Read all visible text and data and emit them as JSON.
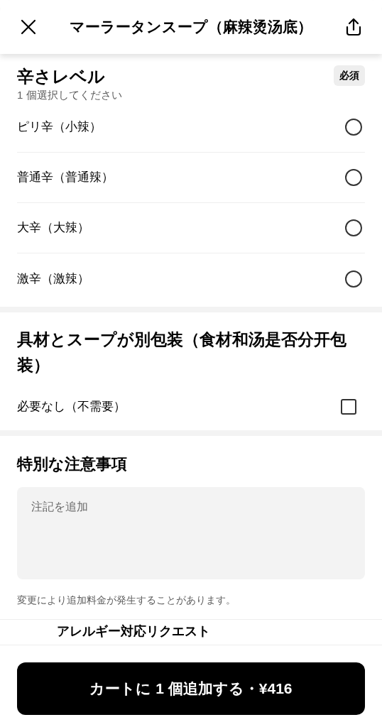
{
  "header": {
    "title": "マーラータンスープ（麻辣烫汤底）"
  },
  "spice_section": {
    "title": "辛さレベル",
    "badge": "必須",
    "subtitle": "1 個選択してください",
    "options": [
      {
        "label": "ピリ辛（小辣）",
        "selected": false
      },
      {
        "label": "普通辛（普通辣）",
        "selected": false
      },
      {
        "label": "大辛（大辣）",
        "selected": false
      },
      {
        "label": "激辛（激辣）",
        "selected": false
      }
    ]
  },
  "packaging_section": {
    "title": "具材とスープが別包装（食材和汤是否分开包装）",
    "options": [
      {
        "label": "必要なし（不需要）",
        "checked": false
      }
    ]
  },
  "notes_section": {
    "title": "特別な注意事項",
    "placeholder": "注記を追加",
    "note": "変更により追加料金が発生することがあります。"
  },
  "allergy_row": {
    "label": "アレルギー対応リクエスト"
  },
  "cart_button": {
    "label": "カートに 1 個追加する・¥416"
  }
}
